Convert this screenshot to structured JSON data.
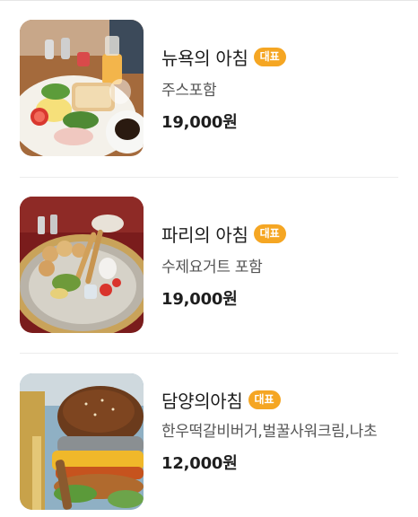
{
  "menu": {
    "items": [
      {
        "name": "뉴욕의 아침",
        "badge": "대표",
        "description": "주스포함",
        "price": "19,000원",
        "image": "new-york-breakfast-plate"
      },
      {
        "name": "파리의 아침",
        "badge": "대표",
        "description": "수제요거트 포함",
        "price": "19,000원",
        "image": "paris-breakfast-silver-tray"
      },
      {
        "name": "담양의아침",
        "badge": "대표",
        "description": "한우떡갈비버거,벌꿀사워크림,나초",
        "price": "12,000원",
        "image": "damyang-burger"
      }
    ]
  },
  "colors": {
    "badge": "#f5a623",
    "price": "#1e1e1e",
    "description": "#555555",
    "divider": "#ececec"
  }
}
